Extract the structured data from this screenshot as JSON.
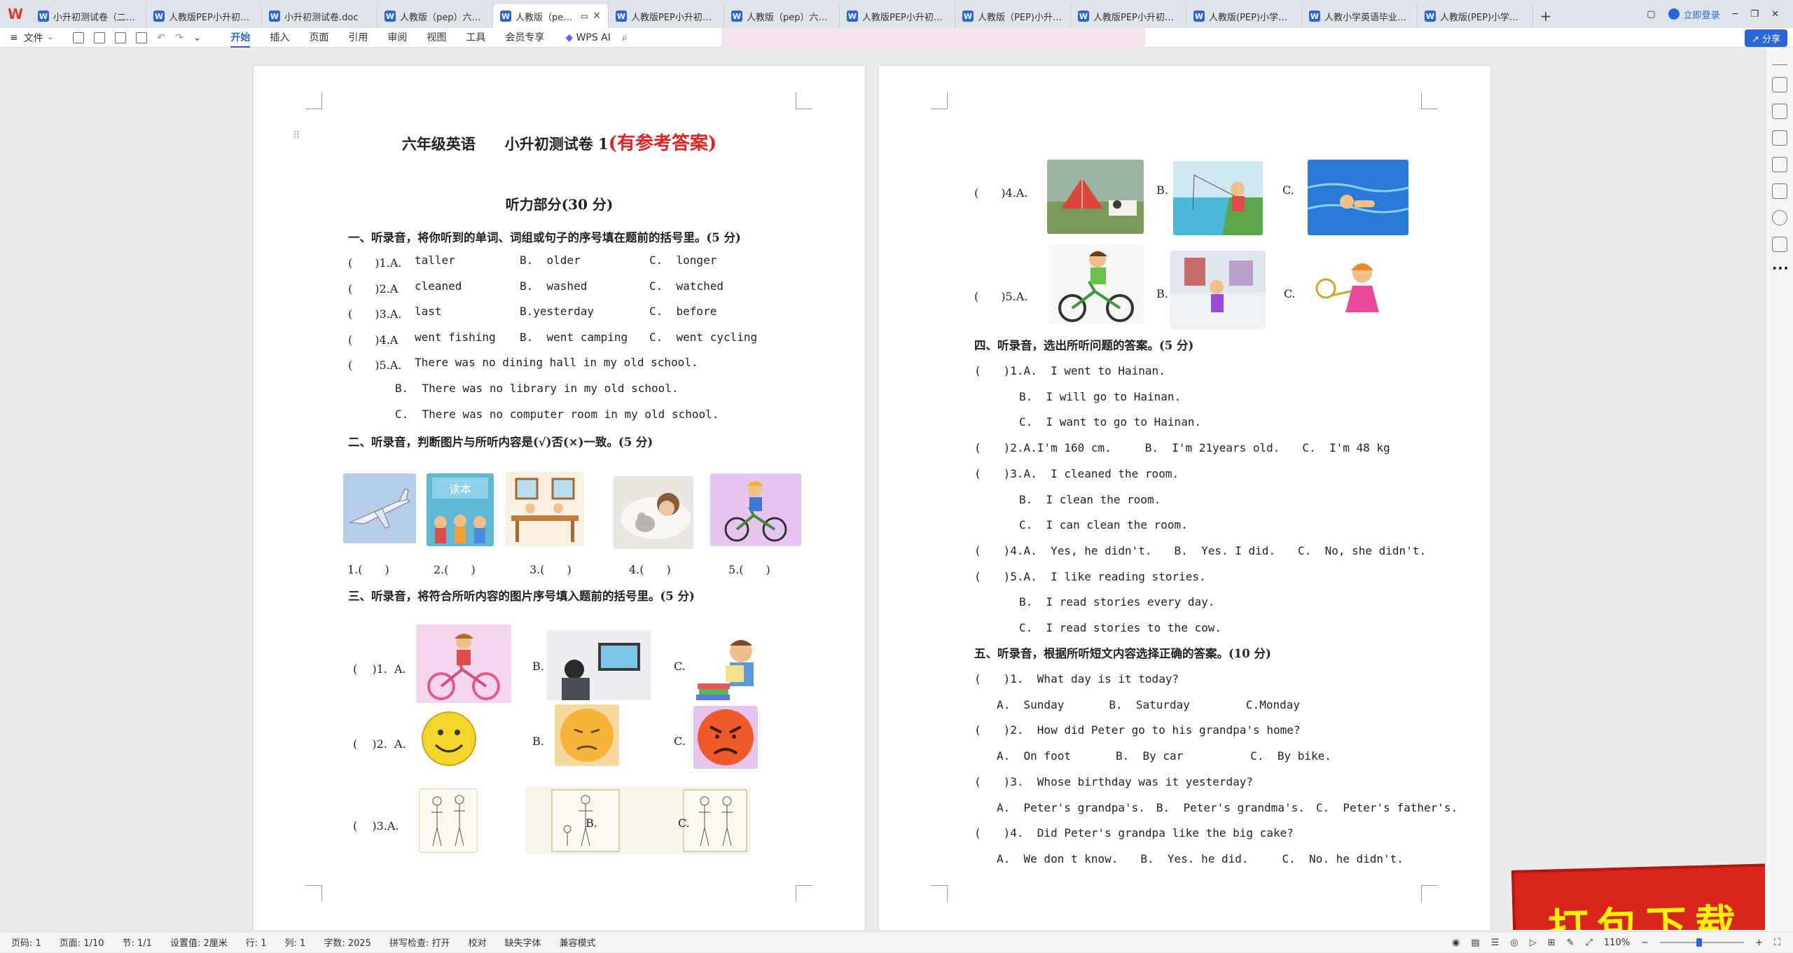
{
  "tabs": [
    {
      "label": "小升初测试卷（二）.do"
    },
    {
      "label": "人教版PEP小升初英语"
    },
    {
      "label": "小升初测试卷.doc"
    },
    {
      "label": "人教版（pep）六年级"
    },
    {
      "label": "人教版（pep）",
      "active": true
    },
    {
      "label": "人教版PEP小升初英语"
    },
    {
      "label": "人教版（pep）六年级"
    },
    {
      "label": "人教版PEP小升初英语"
    },
    {
      "label": "人教版（PEP)小升初·"
    },
    {
      "label": "人教版PEP小升初英语"
    },
    {
      "label": "人教版(PEP)小学英语"
    },
    {
      "label": "人教小学英语毕业升学"
    },
    {
      "label": "人教版(PEP)小学英语"
    }
  ],
  "window": {
    "login": "立即登录"
  },
  "menu": {
    "file": "文件",
    "tabs": [
      "开始",
      "插入",
      "页面",
      "引用",
      "审阅",
      "视图",
      "工具",
      "会员专享"
    ],
    "active": "开始",
    "ai": "WPS AI",
    "share": "分享"
  },
  "page1": {
    "title": "六年级英语　　小升初测试卷 1",
    "title_red": "(有参考答案)",
    "part": "听力部分(30 分)",
    "sec1": "一、听录音，将你听到的单词、词组或句子的序号填在题前的括号里。(5 分)",
    "sec1_rows": [
      {
        "num": "(　　)1.A.",
        "a": "taller",
        "b": "B.  older",
        "c": "C.  longer"
      },
      {
        "num": "(　　)2.A",
        "a": "cleaned",
        "b": "B.  washed",
        "c": "C.  watched"
      },
      {
        "num": "(　　)3.A.",
        "a": "last",
        "b": "B.yesterday",
        "c": "C.  before"
      },
      {
        "num": "(　　)4.A",
        "a": "went fishing",
        "b": "B.  went camping",
        "c": "C.  went cycling"
      }
    ],
    "q5_num": "(　　)5.A.",
    "q5_opts": [
      "There was no dining hall in my old school.",
      "B.  There was no library in my old school.",
      "C.  There was no computer room in my old school."
    ],
    "sec2": "二、听录音，判断图片与所听内容是(√)否(×)一致。(5 分)",
    "sec2_blanks": [
      "1.(　　)",
      "2.(　　)",
      "3.(　　)",
      "4.(　　)",
      "5.(　　)"
    ],
    "sec3": "三、听录音，将符合所听内容的图片序号填入题前的括号里。(5 分)",
    "sec3_rows": [
      {
        "num": "( 　)1.  A.",
        "b": "B.",
        "c": "C."
      },
      {
        "num": "( 　)2.  A.",
        "b": "B.",
        "c": "C."
      },
      {
        "num": "( 　)3.A.",
        "b": "B.",
        "c": "C."
      }
    ]
  },
  "page2": {
    "q4": "(　　)4.A.",
    "q4_b": "B.",
    "q4_c": "C.",
    "q5": "(　　)5.A.",
    "q5_b": "B.",
    "q5_c": "C.",
    "sec4": "四、听录音，选出所听问题的答案。(5 分)",
    "sec4_lines": [
      "(　　)1.A.  I went to Hainan.",
      "　　　　B.  I will go to Hainan.",
      "　　　　C.  I want to go to Hainan.",
      "(　　)2.A.I'm 160 cm.　　　B.  I'm 21years old.　　C.  I'm 48 kg",
      "(　　)3.A.  I cleaned the room.",
      "　　　　B.  I clean the room.",
      "　　　　C.  I can clean the room.",
      "(　　)4.A.  Yes, he didn't.　　B.  Yes. I did.　　C.  No, she didn't.",
      "(　　)5.A.  I like reading stories.",
      "　　　　B.  I read stories every day.",
      "　　　　C.  I read stories to the cow."
    ],
    "sec5": "五、听录音，根据所听短文内容选择正确的答案。(10 分)",
    "sec5_lines": [
      "(　　)1.  What day is it today?",
      "　　A.  Sunday　　　　B.  Saturday　　　　　C.Monday",
      "(　　)2.  How did Peter go to his grandpa's home?",
      "　　A.  On foot　　　　B.  By car　　　　　　C.  By bike.",
      "(　　)3.  Whose birthday was it yesterday?",
      "　　A.  Peter's grandpa's.　B.  Peter's grandma's.　C.  Peter's father's.",
      "(　　)4.  Did Peter's grandpa like the big cake?",
      "　　A.  We don t know.　　B.  Yes. he did.　　　C.  No. he didn't."
    ]
  },
  "status": {
    "items": [
      "页码: 1",
      "页面: 1/10",
      "节: 1/1",
      "设置值: 2厘米",
      "行: 1",
      "列: 1",
      "字数: 2025",
      "拼写检查: 打开",
      "校对",
      "缺失字体",
      "兼容模式"
    ],
    "zoom": "110%"
  },
  "banner": "打包下载"
}
